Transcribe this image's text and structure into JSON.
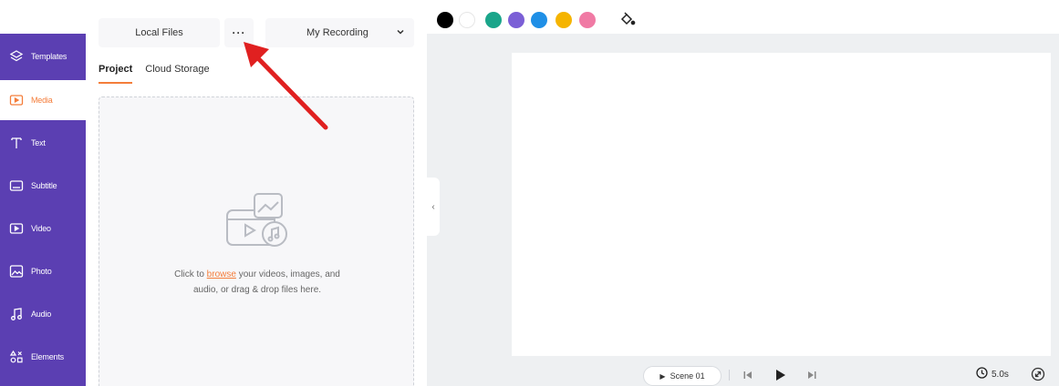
{
  "sidebar": {
    "accent": "#5b3fb2",
    "active_color": "#f47d3a",
    "items": [
      {
        "label": "Templates",
        "icon": "layers-icon"
      },
      {
        "label": "Media",
        "icon": "media-folder-icon"
      },
      {
        "label": "Text",
        "icon": "text-icon"
      },
      {
        "label": "Subtitle",
        "icon": "subtitle-icon"
      },
      {
        "label": "Video",
        "icon": "video-icon"
      },
      {
        "label": "Photo",
        "icon": "photo-icon"
      },
      {
        "label": "Audio",
        "icon": "audio-icon"
      },
      {
        "label": "Elements",
        "icon": "elements-icon"
      }
    ],
    "active": "Media"
  },
  "panel": {
    "local_files": "Local Files",
    "more": "···",
    "recording": "My Recording",
    "tabs": [
      {
        "label": "Project"
      },
      {
        "label": "Cloud Storage"
      }
    ],
    "drop_text_before": "Click to ",
    "drop_link": "browse",
    "drop_text_after": " your videos, images, and",
    "drop_text_line2": "audio, or drag & drop files here."
  },
  "colors": {
    "swatches": [
      "#000000",
      "#ffffff",
      "#1aa58a",
      "#7b5fd6",
      "#1f8fe6",
      "#f5b400",
      "#f07aa4"
    ]
  },
  "bottom": {
    "scene_label": "Scene 01",
    "duration": "5.0s"
  }
}
